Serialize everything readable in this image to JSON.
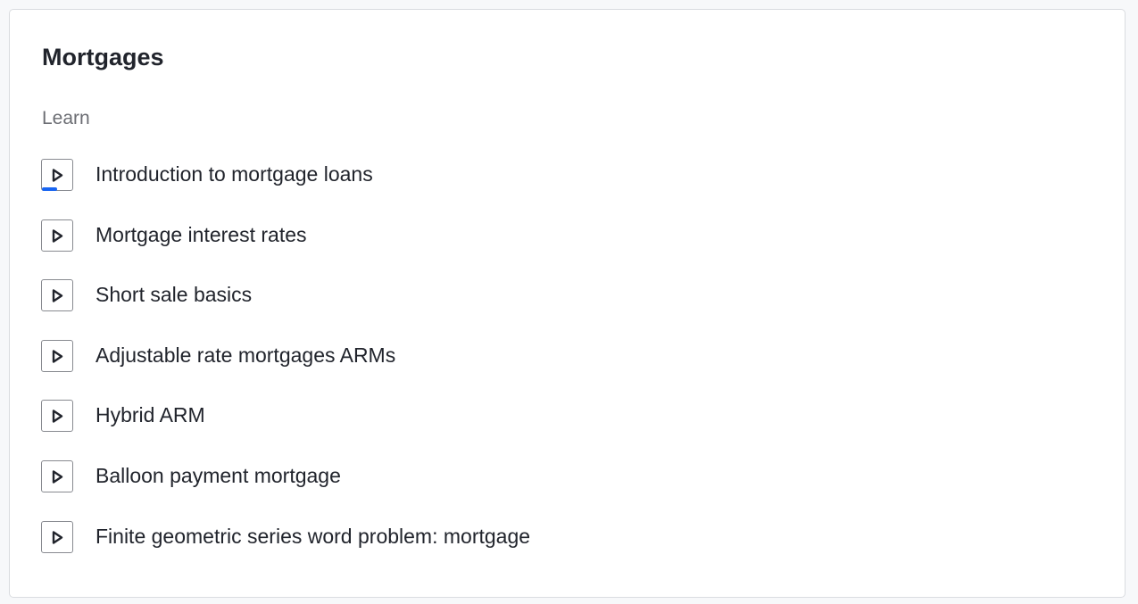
{
  "unit": {
    "title": "Mortgages",
    "section_label": "Learn"
  },
  "lessons": [
    {
      "label": "Introduction to mortgage loans",
      "icon": "play-icon",
      "progress": 0.5
    },
    {
      "label": "Mortgage interest rates",
      "icon": "play-icon",
      "progress": 0
    },
    {
      "label": "Short sale basics",
      "icon": "play-icon",
      "progress": 0
    },
    {
      "label": "Adjustable rate mortgages ARMs",
      "icon": "play-icon",
      "progress": 0
    },
    {
      "label": "Hybrid ARM",
      "icon": "play-icon",
      "progress": 0
    },
    {
      "label": "Balloon payment mortgage",
      "icon": "play-icon",
      "progress": 0
    },
    {
      "label": "Finite geometric series word problem: mortgage",
      "icon": "play-icon",
      "progress": 0
    }
  ],
  "colors": {
    "progress": "#1865f2",
    "text": "#21242c",
    "muted": "#6b6d73"
  }
}
